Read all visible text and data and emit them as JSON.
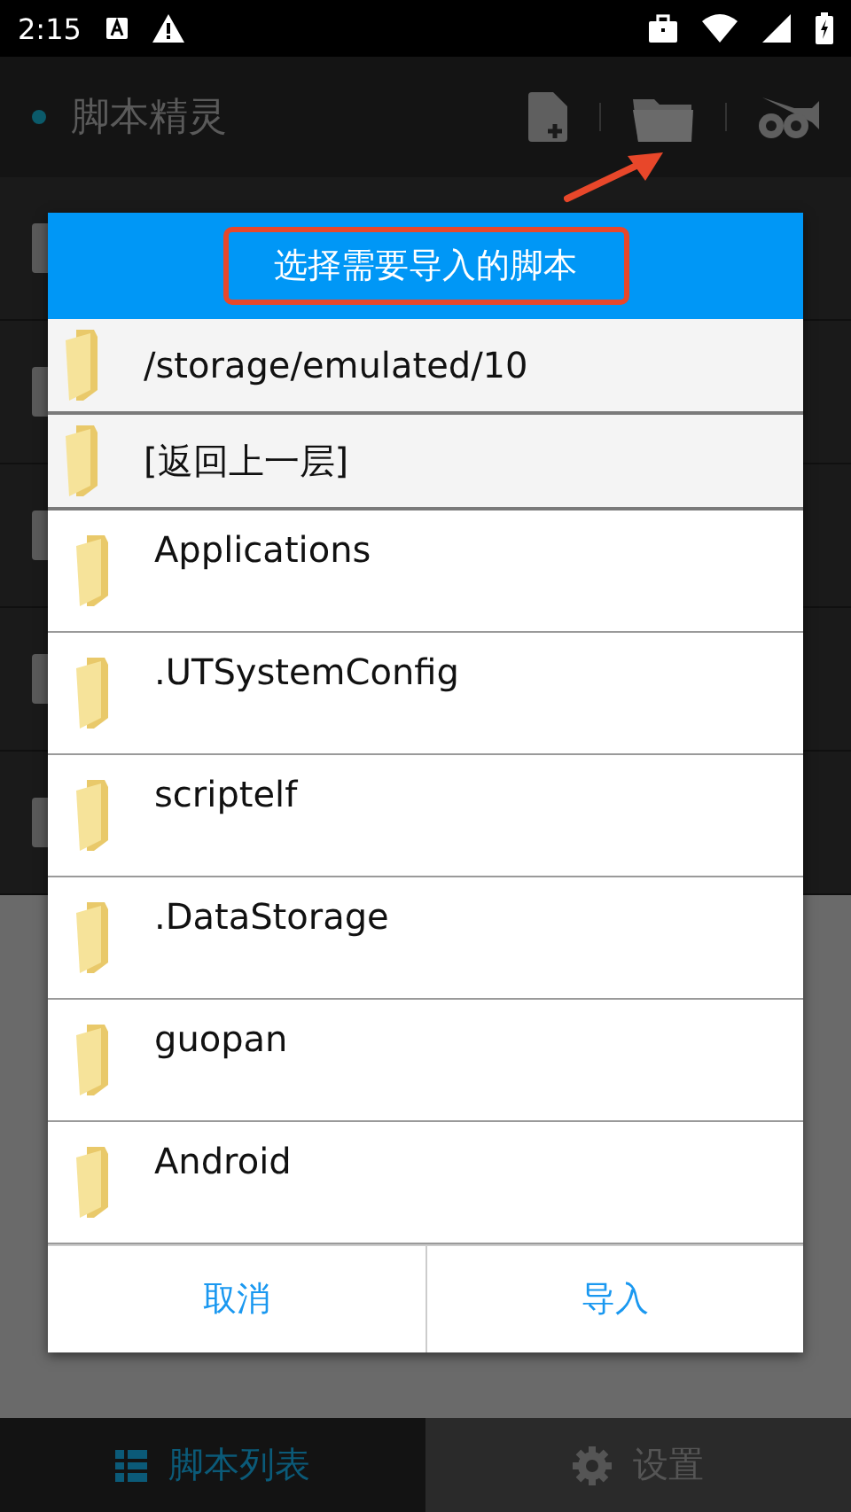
{
  "status_bar": {
    "time": "2:15"
  },
  "app_bar": {
    "title": "脚本精灵"
  },
  "dialog": {
    "title": "选择需要导入的脚本",
    "items": [
      {
        "kind": "header",
        "label": "/storage/emulated/10"
      },
      {
        "kind": "header",
        "label": "[返回上一层]"
      },
      {
        "kind": "folder",
        "label": "Applications"
      },
      {
        "kind": "folder",
        "label": ".UTSystemConfig"
      },
      {
        "kind": "folder",
        "label": "scriptelf"
      },
      {
        "kind": "folder",
        "label": ".DataStorage"
      },
      {
        "kind": "folder",
        "label": "guopan"
      },
      {
        "kind": "folder",
        "label": "Android"
      }
    ],
    "buttons": [
      "取消",
      "导入"
    ]
  },
  "tabs": [
    {
      "label": "脚本列表",
      "selected": true
    },
    {
      "label": "设置",
      "selected": false
    }
  ]
}
